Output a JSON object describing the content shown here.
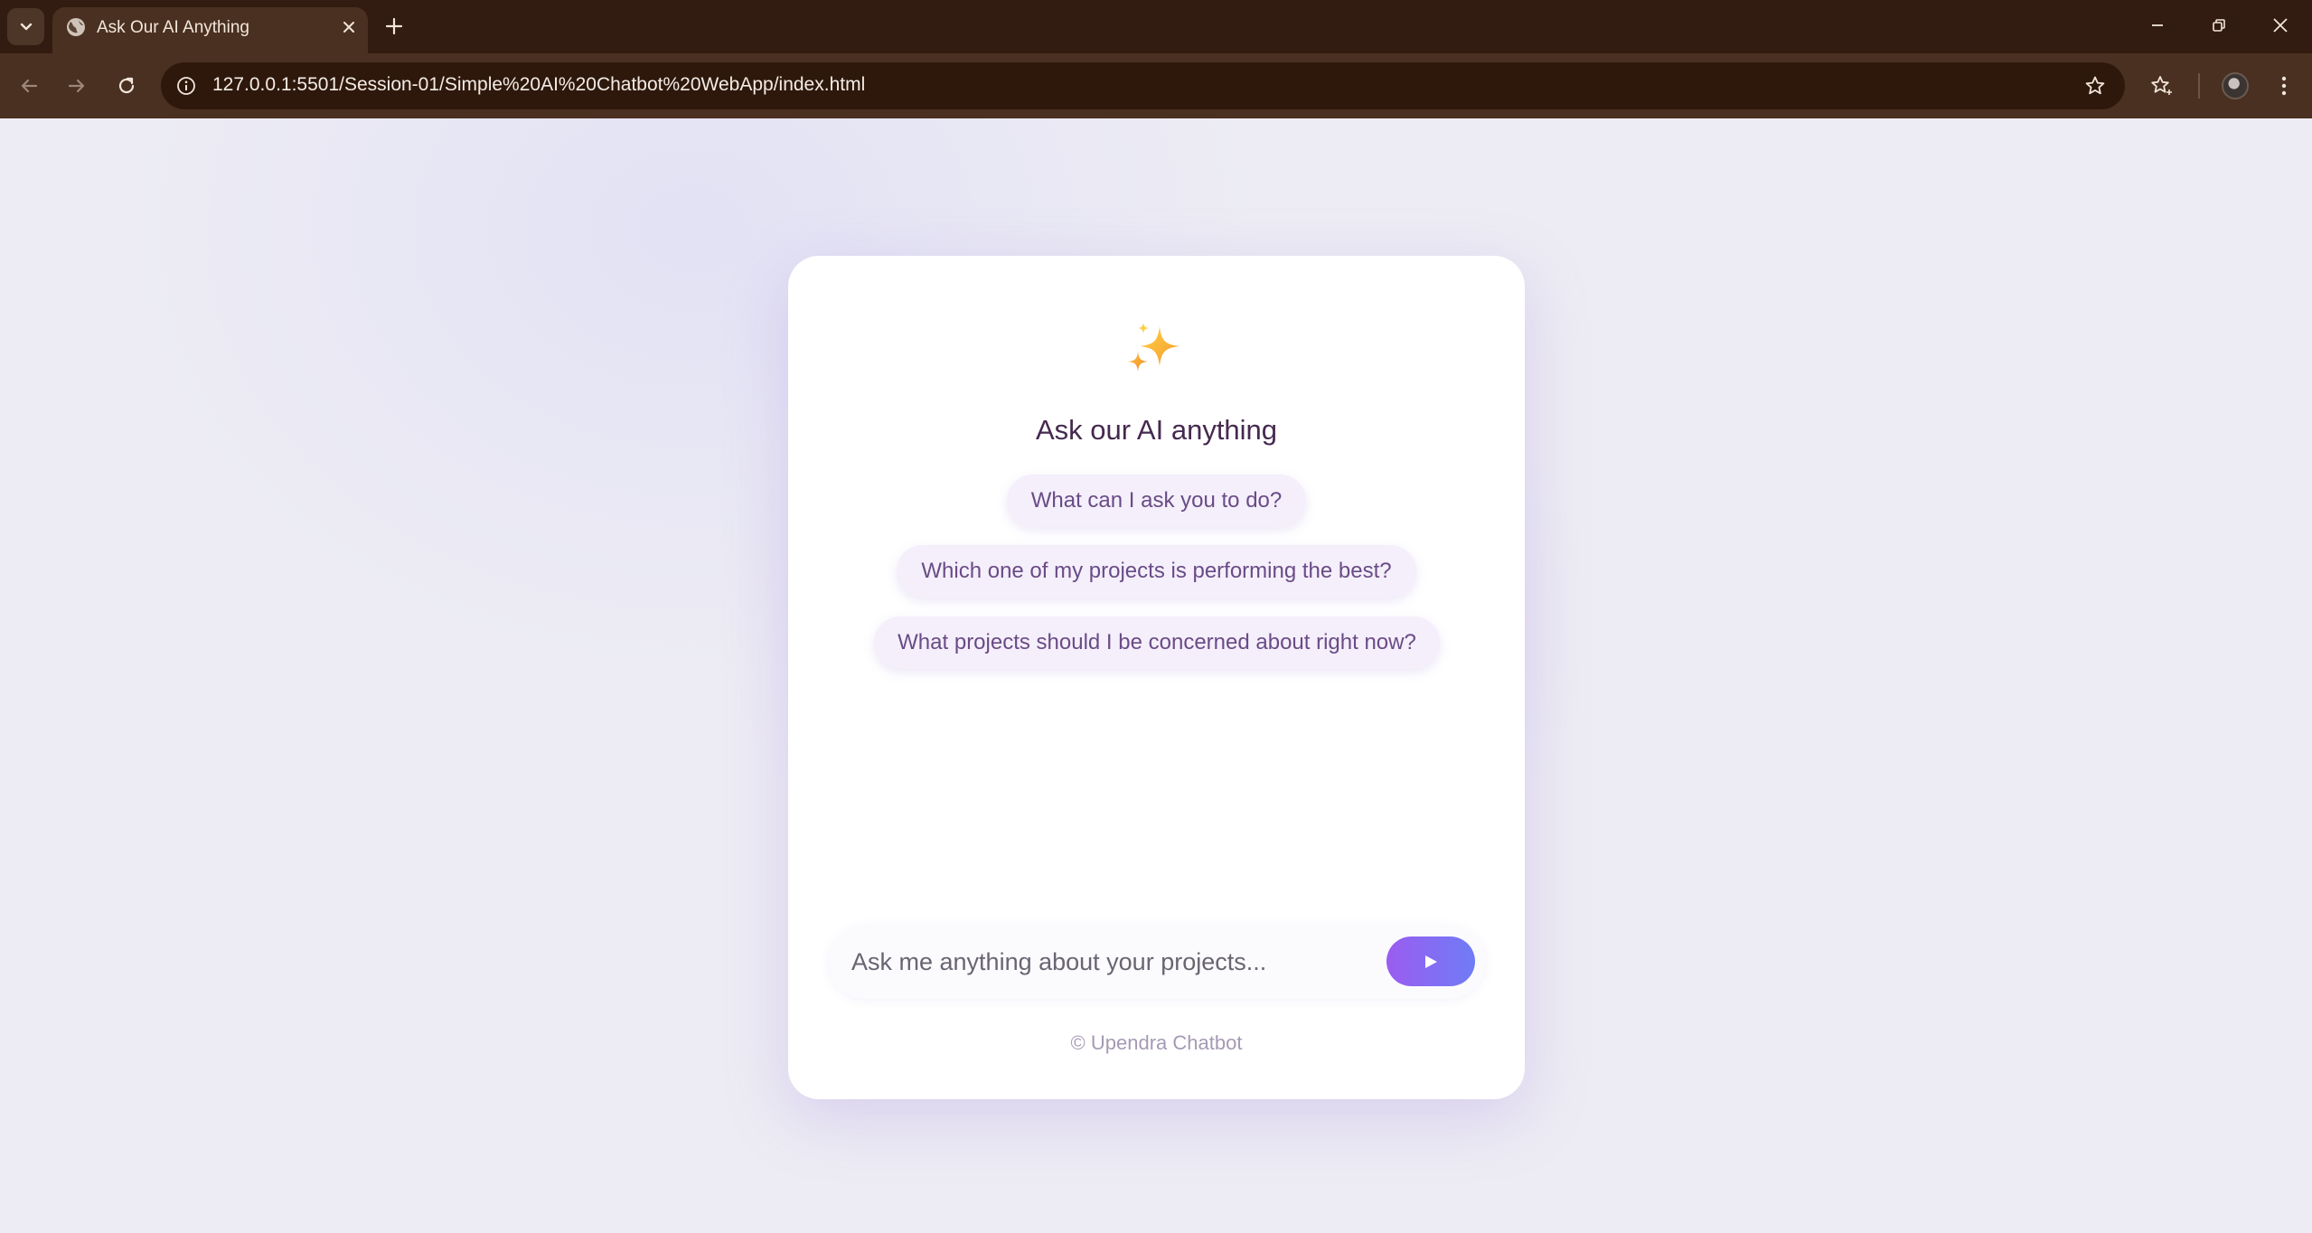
{
  "browser": {
    "tab_title": "Ask Our AI Anything",
    "url": "127.0.0.1:5501/Session-01/Simple%20AI%20Chatbot%20WebApp/index.html",
    "colors": {
      "frame": "#321b10",
      "toolbar": "#4a3020",
      "omnibox": "#2e180c"
    }
  },
  "page": {
    "icon": "sparkles-icon",
    "title": "Ask our AI anything",
    "suggestions": [
      "What can I ask you to do?",
      "Which one of my projects is performing the best?",
      "What projects should I be concerned about right now?"
    ],
    "input_placeholder": "Ask me anything about your projects...",
    "send_icon": "play-triangle-icon",
    "footer": "© Upendra Chatbot",
    "colors": {
      "accent_start": "#9b5cf0",
      "accent_end": "#6f7cf6",
      "chip_bg": "#f4effb",
      "title": "#45294f"
    }
  }
}
